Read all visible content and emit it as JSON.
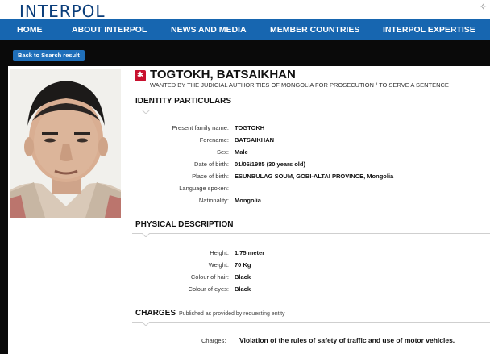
{
  "header": {
    "logo": "INTERPOL"
  },
  "nav": {
    "items": [
      {
        "label": "HOME"
      },
      {
        "label": "ABOUT INTERPOL"
      },
      {
        "label": "NEWS AND MEDIA"
      },
      {
        "label": "MEMBER COUNTRIES"
      },
      {
        "label": "INTERPOL EXPERTISE"
      }
    ]
  },
  "back_button": {
    "label": "Back to Search result"
  },
  "notice": {
    "name": "TOGTOKH, BATSAIKHAN",
    "wanted_by": "WANTED BY THE JUDICIAL AUTHORITIES OF MONGOLIA FOR PROSECUTION / TO SERVE A SENTENCE"
  },
  "identity": {
    "title": "IDENTITY PARTICULARS",
    "rows": [
      {
        "label": "Present family name:",
        "value": "TOGTOKH"
      },
      {
        "label": "Forename:",
        "value": "BATSAIKHAN"
      },
      {
        "label": "Sex:",
        "value": "Male"
      },
      {
        "label": "Date of birth:",
        "value": "01/06/1985 (30 years old)"
      },
      {
        "label": "Place of birth:",
        "value": "ESUNBULAG SOUM, GOBI-ALTAI PROVINCE, Mongolia"
      },
      {
        "label": "Language spoken:",
        "value": ""
      },
      {
        "label": "Nationality:",
        "value": "Mongolia"
      }
    ]
  },
  "physical": {
    "title": "PHYSICAL DESCRIPTION",
    "rows": [
      {
        "label": "Height:",
        "value": "1.75 meter"
      },
      {
        "label": "Weight:",
        "value": "70 Kg"
      },
      {
        "label": "Colour of hair:",
        "value": "Black"
      },
      {
        "label": "Colour of eyes:",
        "value": "Black"
      }
    ]
  },
  "charges": {
    "title": "CHARGES",
    "subtitle": "Published as provided by requesting entity",
    "label": "Charges:",
    "value": "Violation of the rules of safety of traffic and use of motor vehicles."
  },
  "colors": {
    "nav_blue": "#1766b0",
    "logo_blue": "#0a3d7a",
    "badge_red": "#c8102e",
    "dark_band": "#0a0a0a"
  }
}
